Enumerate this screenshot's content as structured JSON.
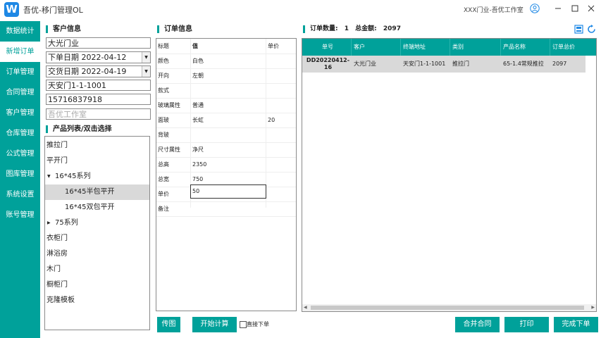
{
  "app": {
    "logo_letter": "W",
    "title": "吾优-移门管理OL",
    "company": "XXX门业-吾优工作室"
  },
  "sidebar": {
    "items": [
      {
        "label": "数据统计"
      },
      {
        "label": "新增订单"
      },
      {
        "label": "订单管理"
      },
      {
        "label": "合同管理"
      },
      {
        "label": "客户管理"
      },
      {
        "label": "仓库管理"
      },
      {
        "label": "公式管理"
      },
      {
        "label": "图库管理"
      },
      {
        "label": "系统设置"
      },
      {
        "label": "账号管理"
      }
    ]
  },
  "customer": {
    "section_title": "客户信息",
    "name": "大光门业",
    "order_date": "下单日期 2022-04-12",
    "delivery_date": "交货日期 2022-04-19",
    "address": "天安门1-1-1001",
    "phone": "15716837918",
    "remark_placeholder": "吾优工作室"
  },
  "products": {
    "section_title": "产品列表/双击选择",
    "items": [
      "推拉门",
      "平开门",
      "16*45系列",
      "16*45半包平开",
      "16*45双包平开",
      "75系列",
      "衣柜门",
      "淋浴房",
      "木门",
      "橱柜门",
      "克隆模板"
    ]
  },
  "order_info": {
    "section_title": "订单信息",
    "headers": [
      "标题",
      "值",
      "单价"
    ],
    "rows": [
      {
        "label": "颜色",
        "value": "白色",
        "price": ""
      },
      {
        "label": "开向",
        "value": "左朝",
        "price": ""
      },
      {
        "label": "款式",
        "value": "",
        "price": ""
      },
      {
        "label": "玻璃属性",
        "value": "普通",
        "price": ""
      },
      {
        "label": "面玻",
        "value": "长虹",
        "price": "20"
      },
      {
        "label": "背玻",
        "value": "",
        "price": ""
      },
      {
        "label": "尺寸属性",
        "value": "净尺",
        "price": ""
      },
      {
        "label": "总高",
        "value": "2350",
        "price": ""
      },
      {
        "label": "总宽",
        "value": "750",
        "price": ""
      },
      {
        "label": "单价",
        "value": "50",
        "price": ""
      },
      {
        "label": "备注",
        "value": "",
        "price": ""
      }
    ]
  },
  "summary": {
    "count_label": "订单数量:",
    "count": "1",
    "total_label": "总金额:",
    "total": "2097"
  },
  "orders_table": {
    "headers": [
      "单号",
      "客户",
      "终端地址",
      "类别",
      "产品名称",
      "订单总价"
    ],
    "rows": [
      {
        "id": "DD20220412-16",
        "customer": "大光门业",
        "address": "天安门1-1-1001",
        "category": "推拉门",
        "product": "65-1.4常规推拉",
        "total": "2097"
      }
    ]
  },
  "buttons": {
    "upload": "传图",
    "calculate": "开始计算",
    "direct_order": "直接下单",
    "merge": "合并合同",
    "print": "打印",
    "complete": "完成下单"
  },
  "colors": {
    "accent": "#00a19a",
    "logo": "#1e88e5",
    "selected_row": "#d9d9d9"
  }
}
